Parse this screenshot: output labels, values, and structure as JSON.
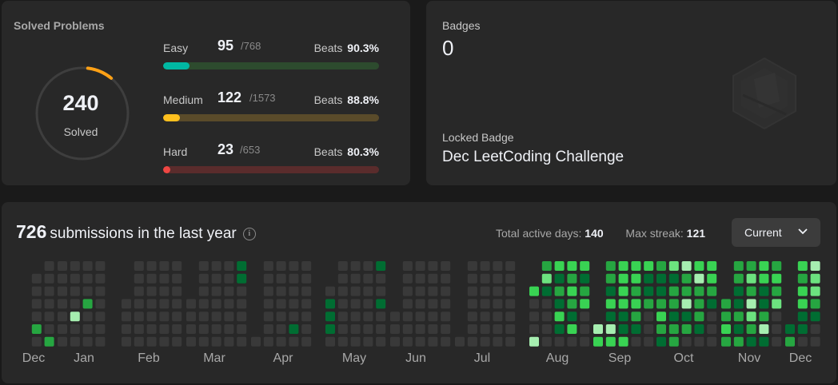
{
  "solved": {
    "title": "Solved Problems",
    "total": "240",
    "total_label": "Solved",
    "ring_fraction": 0.09,
    "ring_color": "#ffa116",
    "difficulties": [
      {
        "name": "Easy",
        "solved": "95",
        "total": "/768",
        "beats_label": "Beats",
        "beats": "90.3%",
        "fraction": 0.124,
        "color": "#00b8a3",
        "track": "#2d4b2e"
      },
      {
        "name": "Medium",
        "solved": "122",
        "total": "/1573",
        "beats_label": "Beats",
        "beats": "88.8%",
        "fraction": 0.078,
        "color": "#ffc01e",
        "track": "#5a4b2a"
      },
      {
        "name": "Hard",
        "solved": "23",
        "total": "/653",
        "beats_label": "Beats",
        "beats": "80.3%",
        "fraction": 0.035,
        "color": "#ef4743",
        "track": "#5a2c2c"
      }
    ]
  },
  "badges": {
    "label": "Badges",
    "count": "0",
    "locked_label": "Locked Badge",
    "locked_name": "Dec LeetCoding Challenge"
  },
  "submissions": {
    "count": "726",
    "text": "submissions in the last year",
    "active_days_label": "Total active days:",
    "active_days": "140",
    "max_streak_label": "Max streak:",
    "max_streak": "121",
    "select_value": "Current",
    "months": [
      "Dec",
      "Jan",
      "Feb",
      "Mar",
      "Apr",
      "May",
      "Jun",
      "Jul",
      "Aug",
      "Sep",
      "Oct",
      "Nov",
      "Dec"
    ],
    "level_colors": [
      "#393939",
      "#0e4429",
      "#006d32",
      "#26a641",
      "#39d353",
      "#6ce27f",
      "#a6eeb0"
    ],
    "heatmap": [
      {
        "month": "Dec",
        "weeks": [
          [
            0
          ],
          [
            null,
            0,
            0,
            0,
            0,
            0,
            0
          ],
          [
            0,
            0,
            0,
            0,
            0,
            0,
            0
          ]
        ],
        "levels": [
          [
            null
          ],
          [
            null,
            0,
            0,
            0,
            0,
            3,
            0
          ],
          [
            0,
            0,
            0,
            0,
            0,
            0,
            3
          ]
        ]
      },
      {
        "month": "Jan",
        "weeks": [
          [
            0,
            0,
            0,
            0,
            0,
            0,
            0
          ],
          [
            0,
            0,
            0,
            0,
            0,
            0,
            0
          ],
          [
            0,
            0,
            0,
            0,
            0,
            0,
            0
          ],
          [
            0,
            0,
            0,
            0,
            0,
            0,
            0
          ]
        ],
        "levels": [
          [
            0,
            0,
            0,
            0,
            0,
            0,
            0
          ],
          [
            0,
            0,
            0,
            0,
            6,
            0,
            0
          ],
          [
            0,
            0,
            0,
            3,
            0,
            0,
            0
          ],
          [
            0,
            0,
            0,
            0,
            0,
            0,
            0
          ]
        ]
      },
      {
        "month": "Feb",
        "weeks": [
          [
            null,
            null,
            null,
            0,
            0,
            0,
            0
          ],
          [
            0,
            0,
            0,
            0,
            0,
            0,
            0
          ],
          [
            0,
            0,
            0,
            0,
            0,
            0,
            0
          ],
          [
            0,
            0,
            0,
            0,
            0,
            0,
            0
          ],
          [
            0,
            0,
            0,
            0,
            0,
            0,
            0
          ]
        ],
        "levels": [
          [
            null,
            null,
            null,
            0,
            0,
            0,
            0
          ],
          [
            0,
            0,
            0,
            0,
            0,
            0,
            0
          ],
          [
            0,
            0,
            0,
            0,
            0,
            0,
            0
          ],
          [
            0,
            0,
            0,
            0,
            0,
            0,
            0
          ],
          [
            0,
            0,
            0,
            0,
            0,
            0,
            0
          ]
        ]
      },
      {
        "month": "Mar",
        "weeks": [
          [
            null,
            null,
            null,
            0,
            0,
            0,
            0
          ],
          [
            0,
            0,
            0,
            0,
            0,
            0,
            0
          ],
          [
            0,
            0,
            0,
            0,
            0,
            0,
            0
          ],
          [
            0,
            0,
            0,
            0,
            0,
            0,
            0
          ],
          [
            2,
            2,
            0,
            0,
            0,
            0,
            0
          ]
        ],
        "levels": [
          [
            null,
            null,
            null,
            0,
            0,
            0,
            0
          ],
          [
            0,
            0,
            0,
            0,
            0,
            0,
            0
          ],
          [
            0,
            0,
            0,
            0,
            0,
            0,
            0
          ],
          [
            0,
            0,
            0,
            0,
            0,
            0,
            0
          ],
          [
            2,
            2,
            0,
            0,
            0,
            0,
            0
          ]
        ]
      },
      {
        "month": "Apr",
        "weeks": [
          [
            null,
            null,
            null,
            null,
            null,
            null,
            0
          ],
          [
            0,
            0,
            0,
            0,
            0,
            0,
            0
          ],
          [
            0,
            0,
            0,
            0,
            0,
            0,
            0
          ],
          [
            0,
            0,
            0,
            0,
            0,
            0,
            0
          ],
          [
            0,
            0,
            0,
            0,
            0,
            0,
            0
          ]
        ],
        "levels": [
          [
            null,
            null,
            null,
            null,
            null,
            null,
            0
          ],
          [
            0,
            0,
            0,
            0,
            0,
            0,
            0
          ],
          [
            0,
            0,
            0,
            0,
            0,
            0,
            0
          ],
          [
            0,
            0,
            0,
            0,
            0,
            2,
            0
          ],
          [
            0,
            0,
            0,
            0,
            0,
            0,
            0
          ]
        ]
      },
      {
        "month": "May",
        "weeks": [
          [
            null,
            null,
            0,
            0,
            0,
            0,
            0
          ],
          [
            0,
            0,
            0,
            0,
            0,
            0,
            0
          ],
          [
            0,
            0,
            0,
            0,
            0,
            0,
            0
          ],
          [
            0,
            0,
            0,
            0,
            0,
            0,
            0
          ],
          [
            2,
            0,
            0,
            2,
            0,
            0,
            0
          ]
        ],
        "levels": [
          [
            null,
            null,
            0,
            2,
            2,
            2,
            0
          ],
          [
            0,
            0,
            0,
            0,
            0,
            0,
            0
          ],
          [
            0,
            0,
            0,
            0,
            0,
            0,
            0
          ],
          [
            0,
            0,
            0,
            0,
            0,
            0,
            0
          ],
          [
            2,
            0,
            0,
            2,
            0,
            0,
            0
          ]
        ]
      },
      {
        "month": "Jun",
        "weeks": [
          [
            null,
            null,
            null,
            null,
            0,
            0,
            0
          ],
          [
            0,
            0,
            0,
            0,
            0,
            0,
            0
          ],
          [
            0,
            0,
            0,
            0,
            0,
            0,
            0
          ],
          [
            0,
            0,
            0,
            0,
            0,
            0,
            0
          ],
          [
            0,
            0,
            0,
            0,
            0,
            0,
            0
          ]
        ],
        "levels": [
          [
            null,
            null,
            null,
            null,
            0,
            0,
            0
          ],
          [
            0,
            0,
            0,
            0,
            0,
            0,
            0
          ],
          [
            0,
            0,
            0,
            0,
            0,
            0,
            0
          ],
          [
            0,
            0,
            0,
            0,
            0,
            0,
            0
          ],
          [
            0,
            0,
            0,
            0,
            0,
            0,
            0
          ]
        ]
      },
      {
        "month": "Jul",
        "weeks": [
          [
            null,
            null,
            null,
            null,
            null,
            null,
            0
          ],
          [
            0,
            0,
            0,
            0,
            0,
            0,
            0
          ],
          [
            0,
            0,
            0,
            0,
            0,
            0,
            0
          ],
          [
            0,
            0,
            0,
            0,
            0,
            0,
            0
          ],
          [
            0,
            0,
            0,
            0,
            0,
            0,
            0
          ]
        ],
        "levels": [
          [
            null,
            null,
            null,
            null,
            null,
            null,
            0
          ],
          [
            0,
            0,
            0,
            0,
            0,
            0,
            0
          ],
          [
            0,
            0,
            0,
            0,
            0,
            0,
            0
          ],
          [
            0,
            0,
            0,
            0,
            0,
            0,
            0
          ],
          [
            0,
            0,
            0,
            0,
            0,
            0,
            0
          ]
        ]
      },
      {
        "month": "Aug",
        "weeks": [
          [
            null,
            null,
            0,
            0,
            0,
            0,
            0
          ],
          [
            0,
            0,
            0,
            0,
            0,
            0,
            0
          ],
          [
            0,
            0,
            0,
            0,
            0,
            0,
            0
          ],
          [
            0,
            0,
            0,
            0,
            0,
            0,
            0
          ],
          [
            0,
            0,
            0,
            0,
            0,
            0,
            0
          ]
        ],
        "levels": [
          [
            null,
            null,
            4,
            0,
            0,
            0,
            6
          ],
          [
            3,
            5,
            2,
            0,
            0,
            0,
            0
          ],
          [
            4,
            2,
            3,
            2,
            4,
            2,
            0
          ],
          [
            4,
            3,
            4,
            3,
            2,
            4,
            0
          ],
          [
            4,
            2,
            3,
            4,
            0,
            0,
            0
          ]
        ]
      },
      {
        "month": "Sep",
        "weeks": [
          [
            null,
            null,
            null,
            null,
            null,
            2,
            4
          ],
          [
            3,
            3,
            2,
            4,
            2,
            6,
            4
          ],
          [
            4,
            4,
            4,
            4,
            2,
            2,
            4
          ],
          [
            4,
            4,
            3,
            4,
            3,
            2,
            0
          ],
          [
            4,
            2,
            2,
            3,
            0,
            0,
            0
          ]
        ],
        "levels": [
          [
            null,
            null,
            null,
            null,
            null,
            6,
            4
          ],
          [
            3,
            3,
            2,
            4,
            2,
            6,
            4
          ],
          [
            4,
            4,
            4,
            4,
            2,
            2,
            4
          ],
          [
            4,
            4,
            3,
            4,
            3,
            2,
            0
          ],
          [
            4,
            2,
            2,
            3,
            0,
            0,
            0
          ]
        ]
      },
      {
        "month": "Oct",
        "weeks": [
          [
            2,
            2,
            2,
            3,
            4,
            3,
            2
          ],
          [
            5,
            2,
            3,
            3,
            2,
            3,
            3
          ],
          [
            6,
            3,
            3,
            6,
            2,
            3,
            0
          ],
          [
            4,
            6,
            3,
            3,
            3,
            2,
            0
          ],
          [
            4,
            4,
            3,
            2,
            0,
            0,
            0
          ]
        ],
        "levels": [
          [
            3,
            2,
            2,
            3,
            4,
            3,
            2
          ],
          [
            5,
            2,
            3,
            3,
            2,
            3,
            3
          ],
          [
            6,
            3,
            3,
            6,
            2,
            3,
            0
          ],
          [
            4,
            6,
            3,
            3,
            3,
            2,
            0
          ],
          [
            4,
            4,
            3,
            2,
            0,
            0,
            0
          ]
        ]
      },
      {
        "month": "Nov",
        "weeks": [
          [
            null,
            null,
            null,
            3,
            3,
            4,
            3
          ],
          [
            3,
            3,
            2,
            2,
            3,
            2,
            3
          ],
          [
            3,
            5,
            3,
            6,
            5,
            3,
            2
          ],
          [
            4,
            4,
            2,
            2,
            3,
            6,
            2
          ],
          [
            3,
            4,
            3,
            5,
            0,
            0,
            0
          ]
        ],
        "levels": [
          [
            null,
            null,
            null,
            3,
            3,
            4,
            3
          ],
          [
            3,
            3,
            2,
            2,
            3,
            2,
            3
          ],
          [
            3,
            5,
            3,
            6,
            5,
            3,
            2
          ],
          [
            4,
            4,
            2,
            2,
            3,
            6,
            2
          ],
          [
            3,
            4,
            3,
            5,
            0,
            0,
            0
          ]
        ]
      },
      {
        "month": "Dec",
        "weeks": [
          [
            null,
            null,
            null,
            null,
            null,
            2,
            3
          ],
          [
            4,
            3,
            4,
            4,
            2,
            2,
            0
          ],
          [
            6,
            5,
            5,
            3,
            2,
            0,
            0
          ]
        ],
        "levels": [
          [
            null,
            null,
            null,
            null,
            null,
            2,
            3
          ],
          [
            4,
            3,
            4,
            4,
            2,
            2,
            0
          ],
          [
            6,
            5,
            5,
            3,
            2,
            0,
            0
          ]
        ]
      }
    ]
  }
}
